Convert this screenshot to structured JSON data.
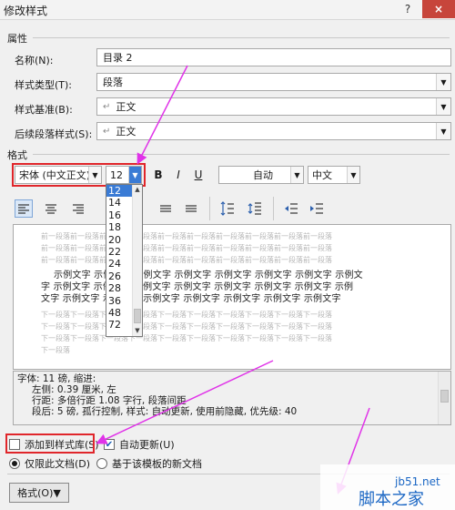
{
  "window": {
    "title": "修改样式",
    "help_glyph": "?",
    "close_glyph": "×"
  },
  "properties": {
    "section": "属性",
    "name_label": "名称(N):",
    "name_value": "目录 2",
    "type_label": "样式类型(T):",
    "type_value": "段落",
    "based_label": "样式基准(B):",
    "based_value": "正文",
    "next_label": "后续段落样式(S):",
    "next_value": "正文",
    "para_mark": "↵"
  },
  "format": {
    "section": "格式",
    "font": "宋体 (中文正文)",
    "size": "12",
    "bold": "B",
    "italic": "I",
    "underline": "U",
    "color": "自动",
    "language": "中文",
    "colors": {
      "highlight_red": "#e0262b",
      "selected_blue": "#3a7bd5",
      "arrow_magenta": "#e033e8"
    }
  },
  "size_options": [
    "12",
    "14",
    "16",
    "18",
    "20",
    "22",
    "24",
    "26",
    "28",
    "36",
    "48",
    "72"
  ],
  "preview": {
    "ghost_before": [
      "前一段落前一段落前一段落前一段落前一段落前一段落前一段落前一段落前一段落前一段落",
      "前一段落前一段落前一段落前一段落前一段落前一段落前一段落前一段落前一段落前一段落",
      "前一段落前一段落前一段落前一段落前一段落前一段落前一段落前一段落前一段落前一段落"
    ],
    "sample_lines": [
      "示例文字 示例文字 示例文字 示例文字 示例文字 示例文字 示例文字 示例文",
      "字 示例文字 示例文字 示例文字 示例文字 示例文字 示例文字 示例文字 示例",
      "文字 示例文字 示例文字 示例文字 示例文字 示例文字 示例文字 示例文字"
    ],
    "ghost_after": [
      "下一段落下一段落下一段落下一段落下一段落下一段落下一段落下一段落下一段落下一段落",
      "下一段落下一段落下一段落下一段落下一段落下一段落下一段落下一段落下一段落下一段落",
      "下一段落下一段落下一段落下一段落下一段落下一段落下一段落下一段落下一段落下一段落",
      "下一段落"
    ]
  },
  "description": {
    "line1": "字体: 11 磅, 缩进:",
    "line2": "左侧:  0.39 厘米, 左",
    "line3": "行距: 多倍行距 1.08 字行, 段落间距",
    "line4": "段后: 5 磅, 孤行控制, 样式: 自动更新, 使用前隐藏, 优先级: 40"
  },
  "options": {
    "add_to_library": "添加到样式库(S)",
    "add_checked": false,
    "auto_update": "自动更新(U)",
    "auto_checked": true,
    "only_doc": "仅限此文档(D)",
    "template_docs": "基于该模板的新文档"
  },
  "footer": {
    "format_button": "格式(O)▼"
  },
  "watermark": {
    "url": "jb51.net",
    "name": "脚本之家"
  }
}
